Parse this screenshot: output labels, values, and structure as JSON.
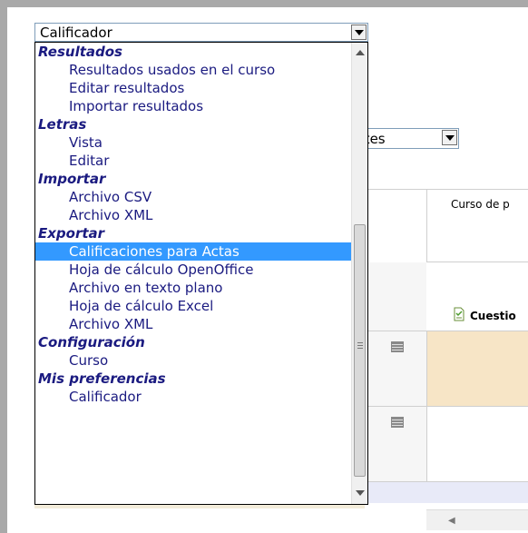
{
  "top_select": {
    "value": "Calificador"
  },
  "view_select": {
    "value": "antes"
  },
  "grid": {
    "course_title": "Curso de p",
    "quiz_label": "Cuestio"
  },
  "dropdown": {
    "groups": [
      {
        "label": "Resultados",
        "options": [
          "Resultados usados en el curso",
          "Editar resultados",
          "Importar resultados"
        ]
      },
      {
        "label": "Letras",
        "options": [
          "Vista",
          "Editar"
        ]
      },
      {
        "label": "Importar",
        "options": [
          "Archivo CSV",
          "Archivo XML"
        ]
      },
      {
        "label": "Exportar",
        "options": [
          "Calificaciones para Actas",
          "Hoja de cálculo OpenOffice",
          "Archivo en texto plano",
          "Hoja de cálculo Excel",
          "Archivo XML"
        ]
      },
      {
        "label": "Configuración",
        "options": [
          "Curso"
        ]
      },
      {
        "label": "Mis preferencias",
        "options": [
          "Calificador"
        ]
      }
    ],
    "selected": "Calificaciones para Actas"
  },
  "colors": {
    "option_text": "#1a1a80",
    "selected_bg": "#3399ff",
    "row_highlight": "#f7e5c6",
    "row_alt": "#e8eaf8"
  }
}
